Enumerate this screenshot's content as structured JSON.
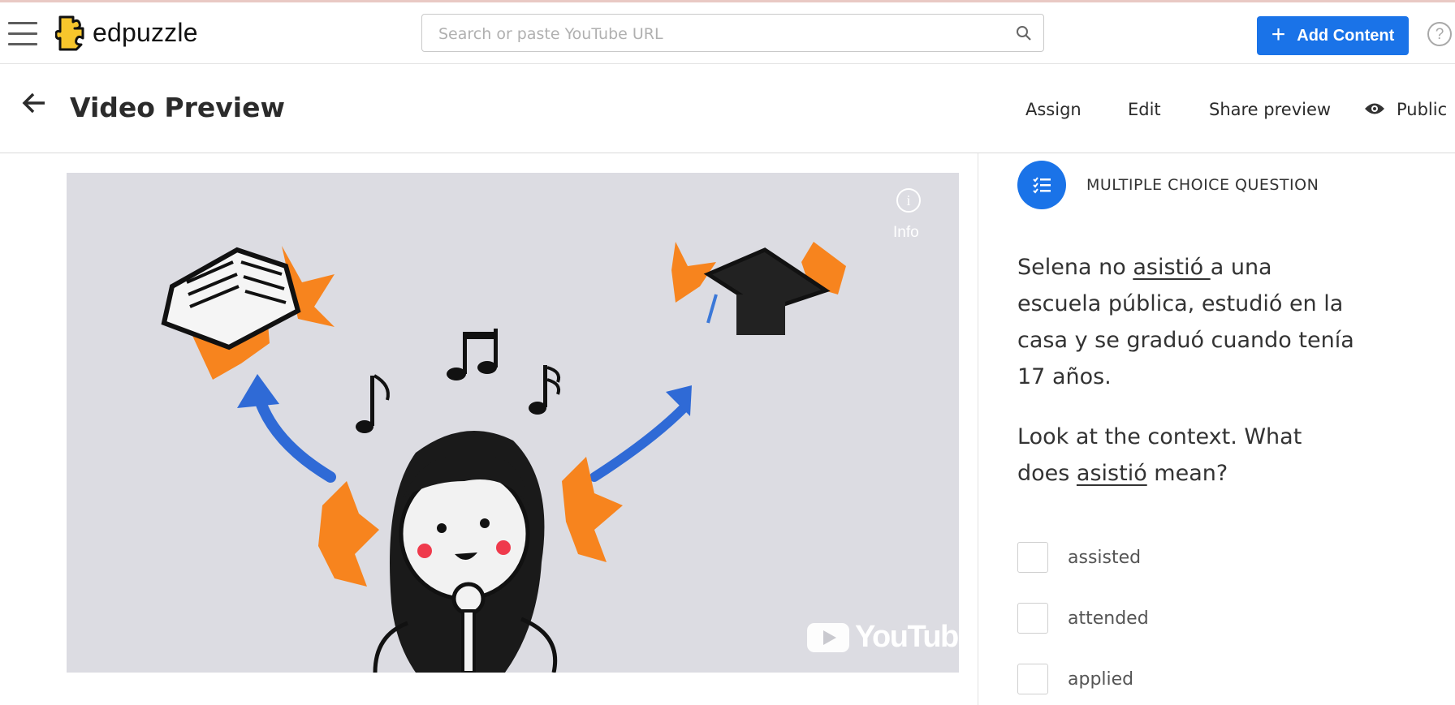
{
  "app": {
    "logo_text": "edpuzzle"
  },
  "search": {
    "placeholder": "Search or paste YouTube URL"
  },
  "header": {
    "add_content_label": "Add Content",
    "help_label": "?"
  },
  "subheader": {
    "title": "Video Preview",
    "assign_label": "Assign",
    "edit_label": "Edit",
    "share_label": "Share preview",
    "visibility_label": "Public"
  },
  "video": {
    "info_label": "Info",
    "info_glyph": "i",
    "player_brand": "YouTube"
  },
  "question": {
    "type_label": "MULTIPLE CHOICE QUESTION",
    "sentence_before": "Selena no ",
    "sentence_word": "asistió ",
    "sentence_after": "a una escuela pública, estudió en la casa y se graduó cuando tenía 17 años.",
    "prompt_before": "Look at the context. What does ",
    "prompt_word": "asistió",
    "prompt_after": " mean?",
    "options": [
      {
        "label": "assisted"
      },
      {
        "label": "attended"
      },
      {
        "label": "applied"
      }
    ]
  },
  "colors": {
    "accent": "#1a73e8",
    "logo_yellow": "#f7c62c",
    "video_bg": "#dcdce2"
  }
}
